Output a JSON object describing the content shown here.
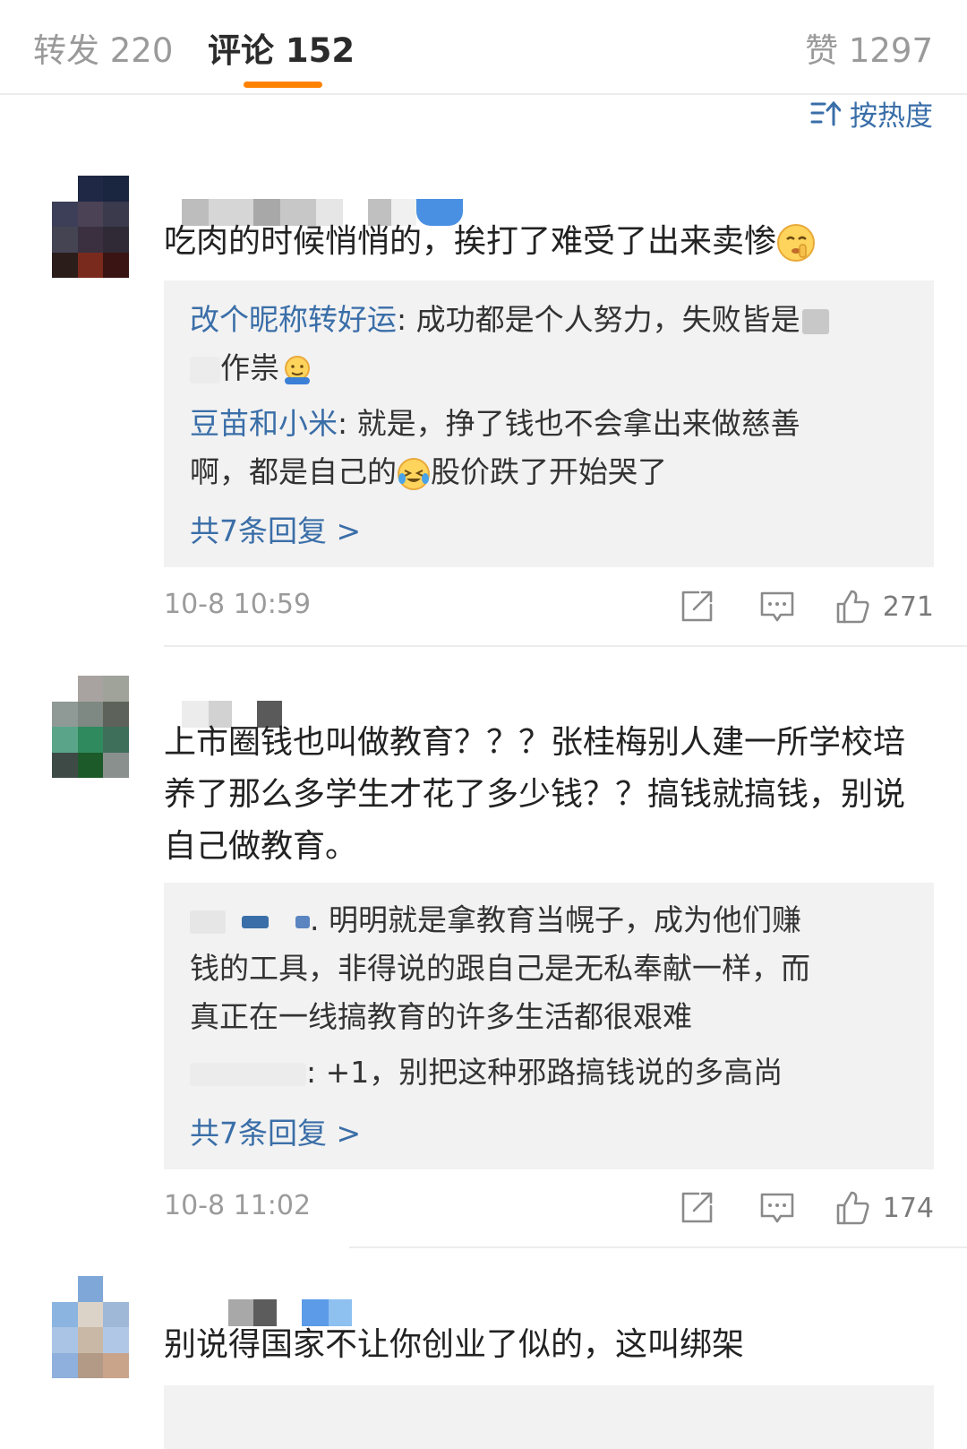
{
  "tabs": {
    "repost": "转发 220",
    "comments": "评论 152",
    "likes": "赞 1297"
  },
  "sort_label": "按热度",
  "comments": [
    {
      "text": "吃肉的时候悄悄的，挨打了难受了出来卖惨",
      "emoji": "shush-face-icon",
      "replies": [
        {
          "name": "改个昵称转好运",
          "text": ": 成功都是个人努力，失败皆是",
          "text2": "作祟"
        },
        {
          "name": "豆苗和小米",
          "text": ": 就是，挣了钱也不会拿出来做慈善",
          "text2a": "啊，都是自己的",
          "text2b": "股价跌了开始哭了"
        }
      ],
      "more": "共7条回复 >",
      "time": "10-8 10:59",
      "likes": "271"
    },
    {
      "text": "上市圈钱也叫做教育？？？张桂梅别人建一所学校培养了那么多学生才花了多少钱？？搞钱就搞钱，别说自己做教育。",
      "replies": [
        {
          "text": ". 明明就是拿教育当幌子，成为他们赚",
          "text2": "钱的工具，非得说的跟自己是无私奉献一样，而",
          "text3": "真正在一线搞教育的许多生活都很艰难"
        },
        {
          "text": ": +1，别把这种邪路搞钱说的多高尚"
        }
      ],
      "more": "共7条回复 >",
      "time": "10-8 11:02",
      "likes": "174"
    },
    {
      "text": "别说得国家不让你创业了似的，这叫绑架"
    }
  ],
  "colors": {
    "accent": "#ff8200",
    "link": "#3a6ea8"
  }
}
